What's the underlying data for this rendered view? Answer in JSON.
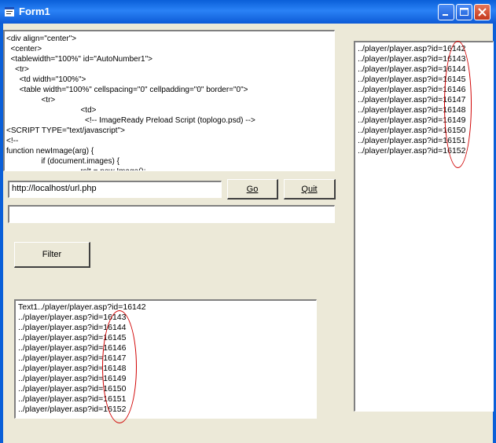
{
  "window": {
    "title": "Form1",
    "accent_color": "#0a5fd8",
    "close_button_color": "#d5492b",
    "controls": [
      "minimize-icon",
      "maximize-icon",
      "close-icon"
    ]
  },
  "source_lines": [
    "<div align=\"center\">",
    "  <center>",
    "  <tablewidth=\"100%\" id=\"AutoNumber1\">",
    "    <tr>",
    "      <td width=\"100%\">",
    "      <table width=\"100%\" cellspacing=\"0\" cellpadding=\"0\" border=\"0\">",
    "                <tr>",
    "                                  <td>",
    "                                    <!-- ImageReady Preload Script (toplogo.psd) -->",
    "<SCRIPT TYPE=\"text/javascript\">",
    "<!--",
    "function newImage(arg) {",
    "                if (document.images) {",
    "                                  rslt = new Image();"
  ],
  "url_input": {
    "value": "http://localhost/url.php"
  },
  "second_input": {
    "value": ""
  },
  "buttons": {
    "go": "Go",
    "quit": "Quit",
    "filter": "Filter"
  },
  "filter_list": [
    "Text1../player/player.asp?id=16142",
    "../player/player.asp?id=16143",
    "../player/player.asp?id=16144",
    "../player/player.asp?id=16145",
    "../player/player.asp?id=16146",
    "../player/player.asp?id=16147",
    "../player/player.asp?id=16148",
    "../player/player.asp?id=16149",
    "../player/player.asp?id=16150",
    "../player/player.asp?id=16151",
    "../player/player.asp?id=16152"
  ],
  "right_list": [
    "../player/player.asp?id=16142",
    "../player/player.asp?id=16143",
    "../player/player.asp?id=16144",
    "../player/player.asp?id=16145",
    "../player/player.asp?id=16146",
    "../player/player.asp?id=16147",
    "../player/player.asp?id=16148",
    "../player/player.asp?id=16149",
    "../player/player.asp?id=16150",
    "../player/player.asp?id=16151",
    "../player/player.asp?id=16152"
  ],
  "annotation_color": "#d00000"
}
